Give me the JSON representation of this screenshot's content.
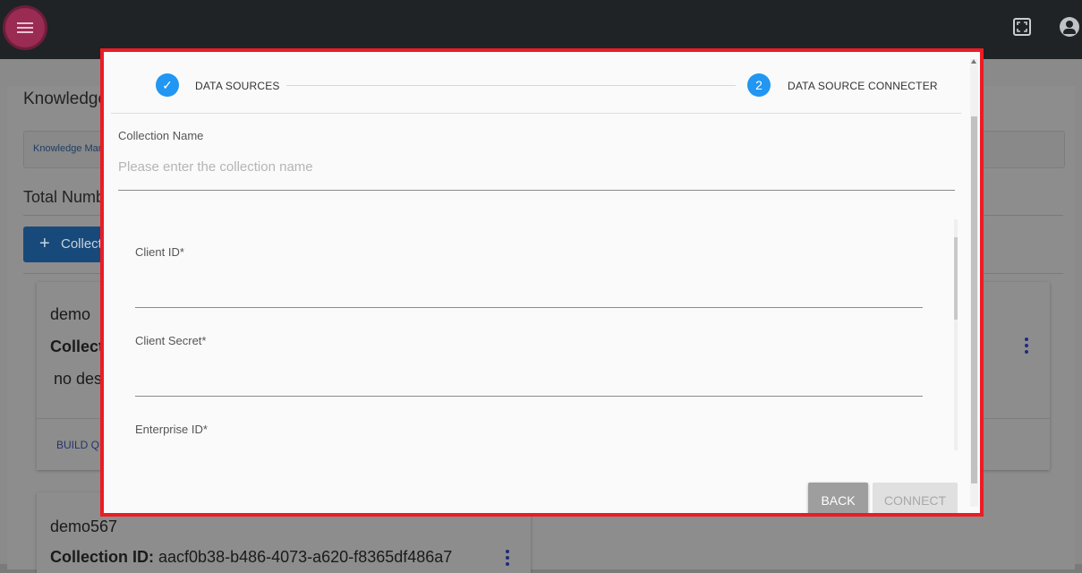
{
  "header": {
    "menu_icon": "hamburger-menu-icon",
    "fullscreen_icon": "fullscreen-icon",
    "account_icon": "account-circle-icon"
  },
  "background": {
    "title": "Knowledge",
    "breadcrumb": "Knowledge Man",
    "total": "Total Numb",
    "add_button": "Collect",
    "cards": [
      {
        "name": "demo",
        "collection_label": "Collecti",
        "description": "no des",
        "action": "BUILD QU"
      },
      {
        "name": "demo567",
        "collection_label": "Collection ID:",
        "collection_id": "aacf0b38-b486-4073-a620-f8365df486a7"
      }
    ]
  },
  "modal": {
    "steps": [
      {
        "marker": "✓",
        "label": "DATA SOURCES",
        "state": "completed"
      },
      {
        "marker": "2",
        "label": "DATA SOURCE CONNECTER",
        "state": "active"
      }
    ],
    "collection_name": {
      "label": "Collection Name",
      "placeholder": "Please enter the collection name"
    },
    "fields": [
      {
        "label": "Client ID*",
        "value": ""
      },
      {
        "label": "Client Secret*",
        "value": ""
      },
      {
        "label": "Enterprise ID*",
        "value": ""
      }
    ],
    "buttons": {
      "back": "BACK",
      "connect": "CONNECT"
    },
    "accent_color": "#2196f3",
    "highlight_border_color": "#ec1c24"
  }
}
